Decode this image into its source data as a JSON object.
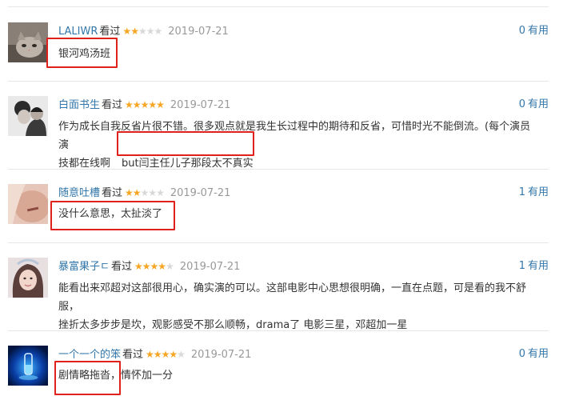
{
  "labels": {
    "watched": "看过",
    "useful": "有用"
  },
  "colors": {
    "star": "#f6a623",
    "star_empty": "#d8d8d8",
    "link": "#3377aa",
    "highlight": "#e0201b"
  },
  "reviews": [
    {
      "user": "LALIWR",
      "rating": 2,
      "date": "2019-07-21",
      "votes": "0",
      "lines": [
        "银河鸡汤班"
      ],
      "avatar": "cat-photo"
    },
    {
      "user": "白面书生",
      "rating": 5,
      "date": "2019-07-21",
      "votes": "0",
      "lines": [
        "作为成长自我反省片很不错。很多观点就是我生长过程中的期待和反省，可惜时光不能倒流。(每个演员演",
        "技都在线啊"
      ],
      "highlight_text": "but闫主任儿子那段太不真实",
      "avatar": "child-photo"
    },
    {
      "user": "随意吐槽",
      "rating": 2,
      "date": "2019-07-21",
      "votes": "1",
      "lines": [
        "没什么意思，太扯淡了"
      ],
      "avatar": "portrait-photo"
    },
    {
      "user": "暴富果子ㄷ",
      "rating": 4,
      "date": "2019-07-21",
      "votes": "1",
      "lines": [
        "能看出来邓超对这部很用心，确实演的可以。这部电影中心思想很明确，一直在点题，可是看的我不舒服，",
        "挫折太多步步是坎，观影感受不那么顺畅，drama了 电影三星，邓超加一星"
      ],
      "avatar": "woman-photo"
    },
    {
      "user": "一个一个的笨",
      "rating": 4,
      "date": "2019-07-21",
      "votes": "0",
      "lines": [
        "剧情略拖沓，情怀加一分"
      ],
      "avatar": "blue-glass-photo"
    }
  ]
}
